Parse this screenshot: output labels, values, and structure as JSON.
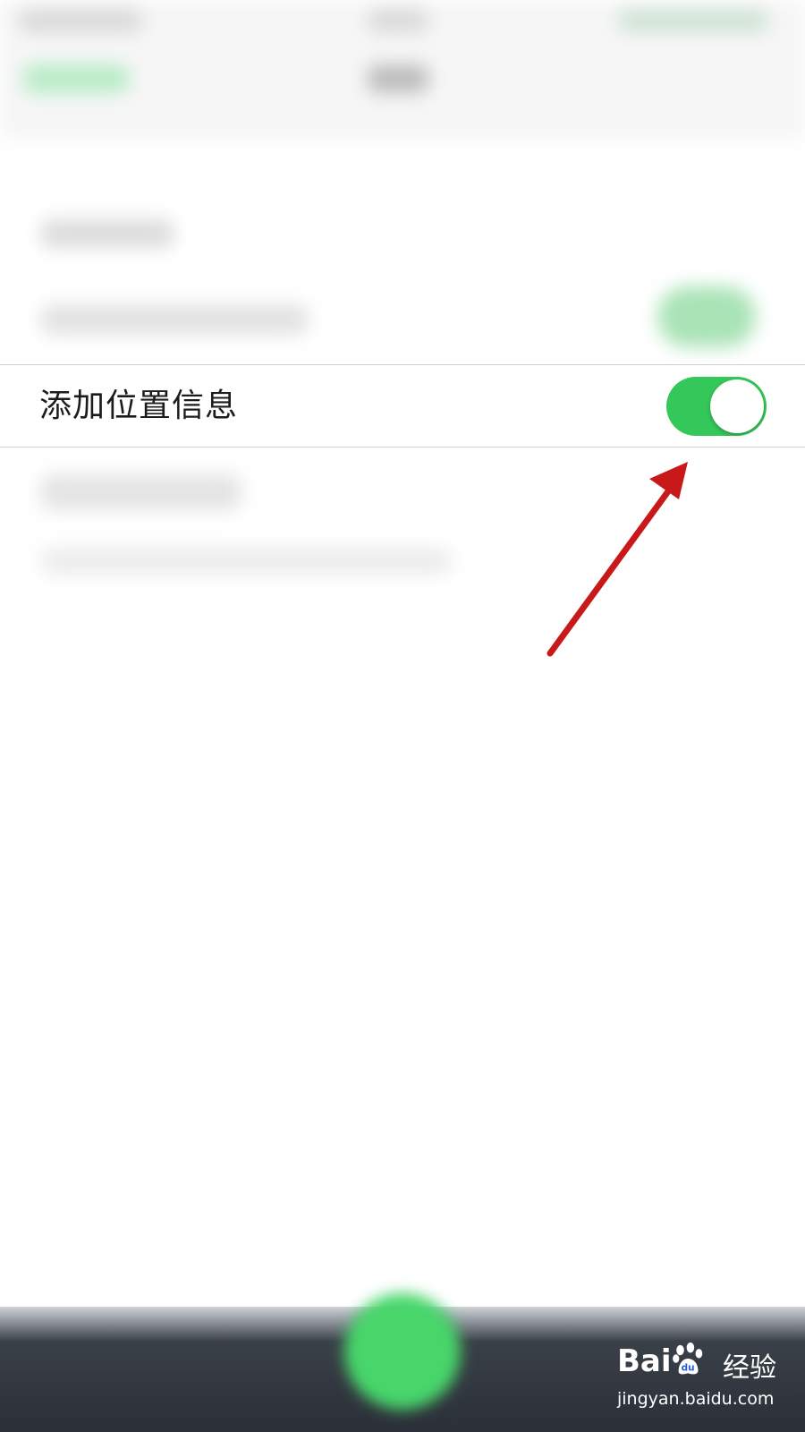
{
  "setting_row": {
    "label": "添加位置信息",
    "toggle_on": true
  },
  "watermark": {
    "brand_left": "Bai",
    "brand_right": "经验",
    "url": "jingyan.baidu.com"
  },
  "colors": {
    "toggle_on": "#34c759",
    "arrow": "#c8181a",
    "tabbar_center": "#48d66b"
  },
  "icons": {
    "annotation": "red-arrow-icon",
    "watermark_logo": "baidu-paw-icon"
  }
}
